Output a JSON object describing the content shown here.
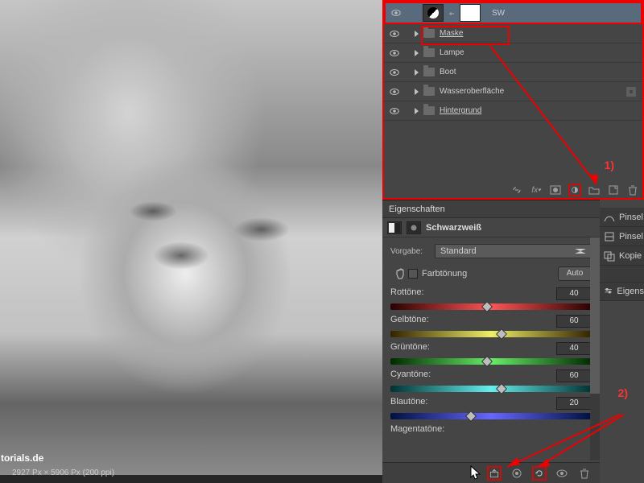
{
  "watermark": "torials.de",
  "status_text": "2927 Px × 5906 Px (200 ppi)",
  "layers": {
    "selected": {
      "name": "SW"
    },
    "groups": [
      {
        "name": "Maske"
      },
      {
        "name": "Lampe"
      },
      {
        "name": "Boot"
      },
      {
        "name": "Wasseroberfläche"
      },
      {
        "name": "Hintergrund"
      }
    ]
  },
  "annotations": {
    "label1": "1)",
    "label2": "2)"
  },
  "properties": {
    "tab": "Eigenschaften",
    "title": "Schwarzweiß",
    "preset_label": "Vorgabe:",
    "preset_value": "Standard",
    "tint_label": "Farbtönung",
    "auto_label": "Auto",
    "sliders": {
      "red": {
        "label": "Rottöne:",
        "value": "40",
        "pos": 48
      },
      "yellow": {
        "label": "Gelbtöne:",
        "value": "60",
        "pos": 55
      },
      "green": {
        "label": "Grüntöne:",
        "value": "40",
        "pos": 48
      },
      "cyan": {
        "label": "Cyantöne:",
        "value": "60",
        "pos": 55
      },
      "blue": {
        "label": "Blautöne:",
        "value": "20",
        "pos": 40
      },
      "magenta": {
        "label": "Magentatöne:",
        "value": "",
        "pos": 60
      }
    }
  },
  "side_tabs": {
    "a": "Pinsel",
    "b": "Pinsel",
    "c": "Kopie",
    "d": "Eigens"
  }
}
